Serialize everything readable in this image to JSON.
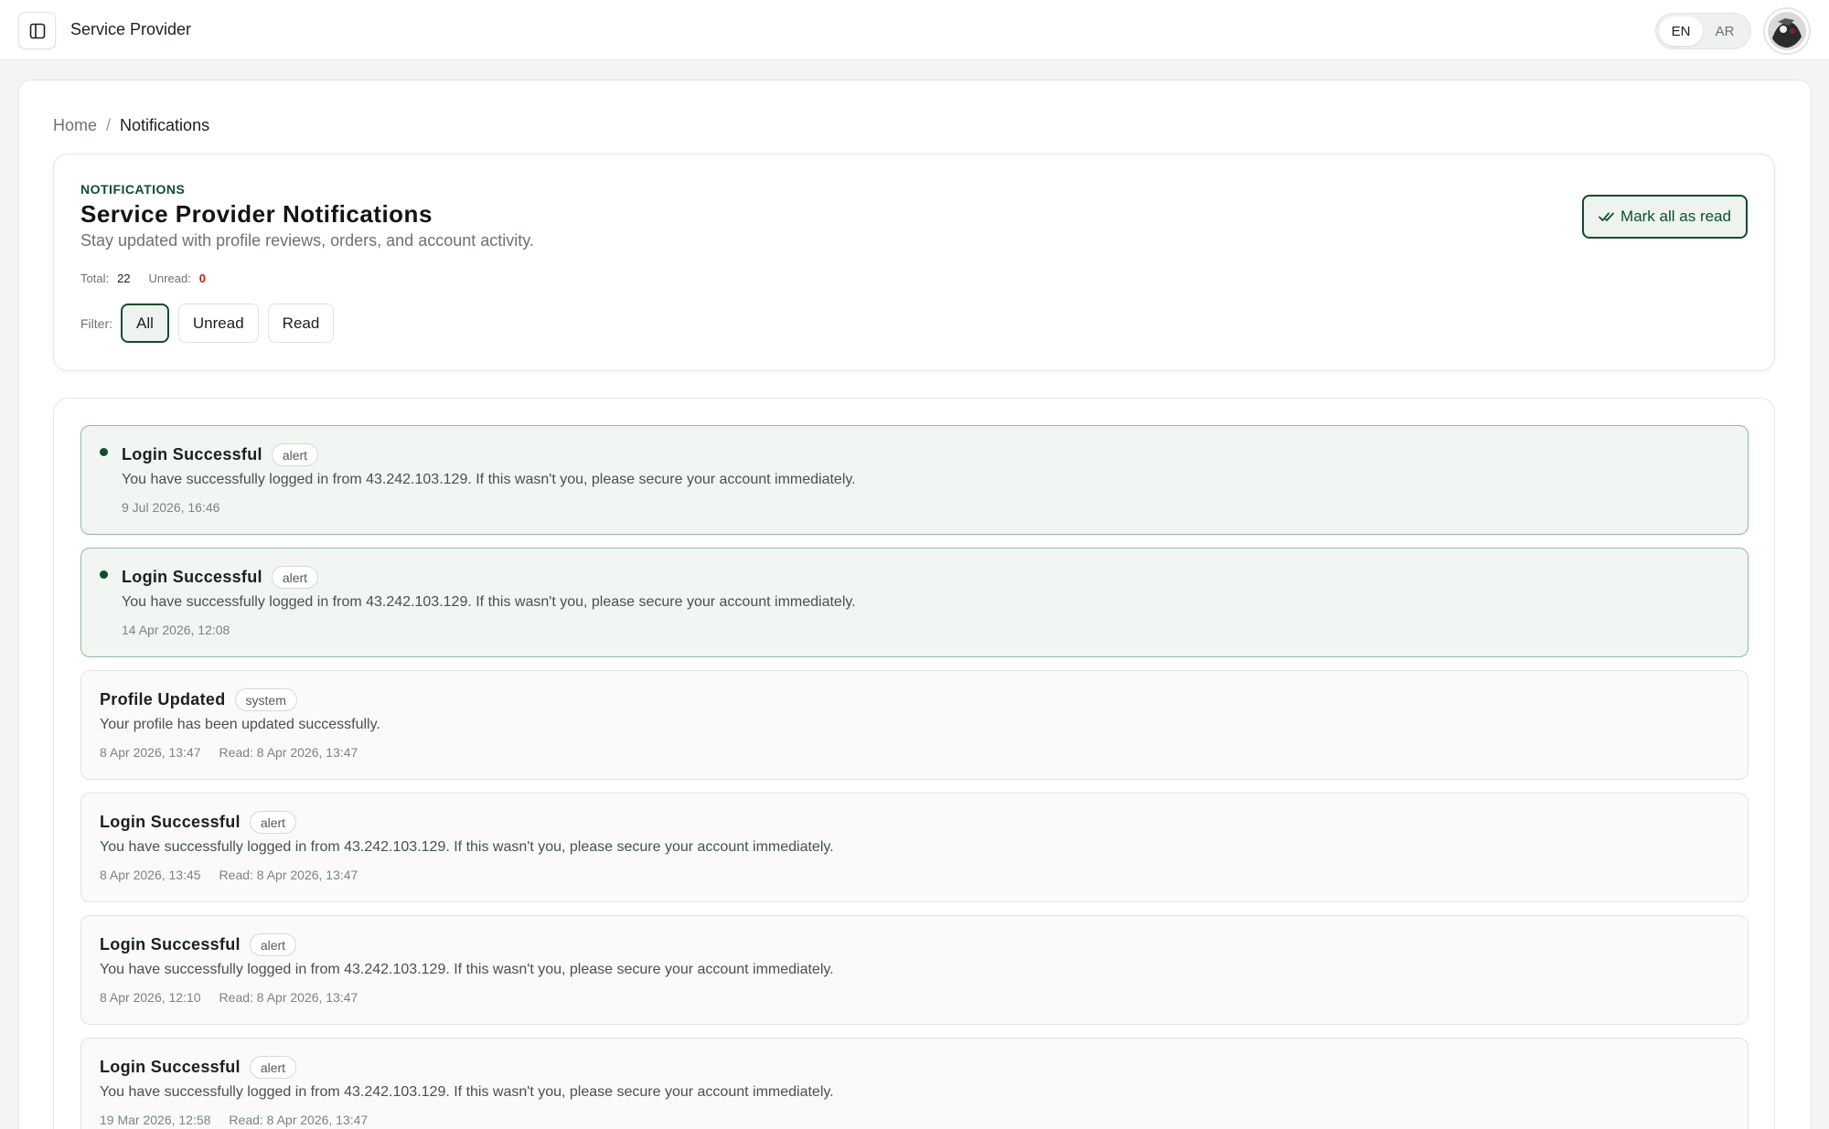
{
  "topbar": {
    "app_title": "Service Provider",
    "lang_en": "EN",
    "lang_ar": "AR"
  },
  "breadcrumb": {
    "home": "Home",
    "separator": "/",
    "current": "Notifications"
  },
  "header": {
    "eyebrow": "NOTIFICATIONS",
    "title": "Service Provider Notifications",
    "subtitle": "Stay updated with profile reviews, orders, and account activity.",
    "total_label": "Total:",
    "total_value": "22",
    "unread_label": "Unread:",
    "unread_value": "0",
    "filter_label": "Filter:",
    "filters": [
      "All",
      "Unread",
      "Read"
    ],
    "active_filter": "All",
    "mark_all_label": "Mark all as read"
  },
  "colors": {
    "accent": "#0f4d2c",
    "unread_count": "#c81e1e",
    "unread_card_bg": "#f1f6f2"
  },
  "notifications": [
    {
      "title": "Login Successful",
      "badge": "alert",
      "body": "You have successfully logged in from 43.242.103.129. If this wasn't you, please secure your account immediately.",
      "time": "9 Jul 2026, 16:46",
      "read_at": "",
      "unread": true
    },
    {
      "title": "Login Successful",
      "badge": "alert",
      "body": "You have successfully logged in from 43.242.103.129. If this wasn't you, please secure your account immediately.",
      "time": "14 Apr 2026, 12:08",
      "read_at": "",
      "unread": true
    },
    {
      "title": "Profile Updated",
      "badge": "system",
      "body": "Your profile has been updated successfully.",
      "time": "8 Apr 2026, 13:47",
      "read_at": "Read: 8 Apr 2026, 13:47",
      "unread": false
    },
    {
      "title": "Login Successful",
      "badge": "alert",
      "body": "You have successfully logged in from 43.242.103.129. If this wasn't you, please secure your account immediately.",
      "time": "8 Apr 2026, 13:45",
      "read_at": "Read: 8 Apr 2026, 13:47",
      "unread": false
    },
    {
      "title": "Login Successful",
      "badge": "alert",
      "body": "You have successfully logged in from 43.242.103.129. If this wasn't you, please secure your account immediately.",
      "time": "8 Apr 2026, 12:10",
      "read_at": "Read: 8 Apr 2026, 13:47",
      "unread": false
    },
    {
      "title": "Login Successful",
      "badge": "alert",
      "body": "You have successfully logged in from 43.242.103.129. If this wasn't you, please secure your account immediately.",
      "time": "19 Mar 2026, 12:58",
      "read_at": "Read: 8 Apr 2026, 13:47",
      "unread": false
    }
  ]
}
